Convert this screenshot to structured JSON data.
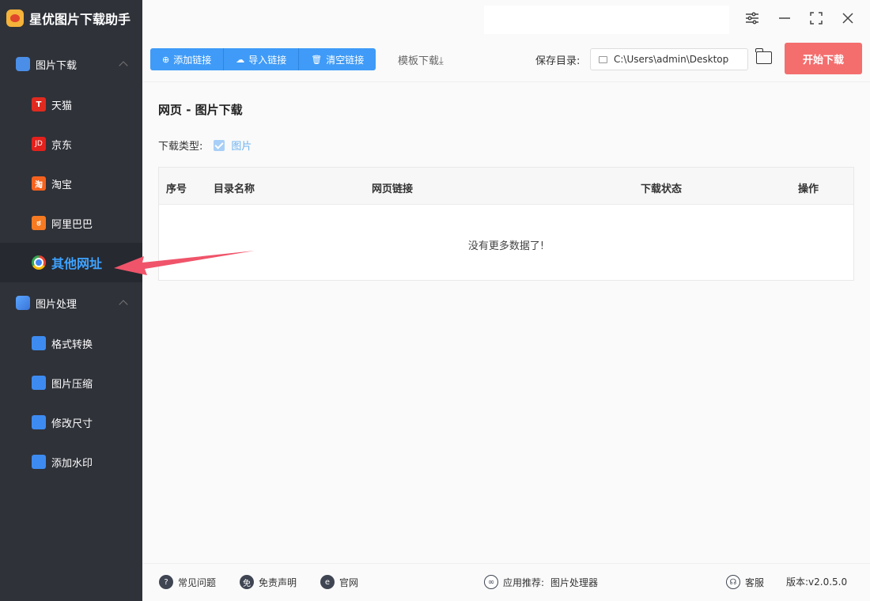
{
  "app": {
    "title": "星优图片下载助手"
  },
  "sidebar": {
    "sections": [
      {
        "label": "图片下载",
        "items": [
          {
            "label": "天猫",
            "icon": "tmall-icon",
            "glyph": "T"
          },
          {
            "label": "京东",
            "icon": "jd-icon",
            "glyph": "JD"
          },
          {
            "label": "淘宝",
            "icon": "taobao-icon",
            "glyph": "淘"
          },
          {
            "label": "阿里巴巴",
            "icon": "alibaba-icon",
            "glyph": "ಠ"
          },
          {
            "label": "其他网址",
            "icon": "chrome-icon",
            "glyph": "",
            "active": true
          }
        ]
      },
      {
        "label": "图片处理",
        "items": [
          {
            "label": "格式转换",
            "icon": "format-convert-icon"
          },
          {
            "label": "图片压缩",
            "icon": "image-compress-icon"
          },
          {
            "label": "修改尺寸",
            "icon": "resize-icon"
          },
          {
            "label": "添加水印",
            "icon": "watermark-icon"
          }
        ]
      }
    ]
  },
  "toolbar": {
    "add_link": "添加链接",
    "import_link": "导入链接",
    "clear_link": "清空链接",
    "template_download": "模板下载",
    "save_dir_label": "保存目录:",
    "save_dir_value": "C:\\Users\\admin\\Desktop",
    "start_download": "开始下载"
  },
  "main": {
    "title": "网页 - 图片下载",
    "download_type_label": "下载类型:",
    "download_type_option": "图片",
    "table": {
      "columns": [
        "序号",
        "目录名称",
        "网页链接",
        "下载状态",
        "操作"
      ],
      "empty_text": "没有更多数据了!"
    }
  },
  "footer": {
    "faq": "常见问题",
    "disclaimer": "免责声明",
    "website": "官网",
    "recommend_label": "应用推荐:",
    "recommend_value": "图片处理器",
    "support": "客服",
    "version": "版本:v2.0.5.0"
  },
  "colors": {
    "sidebar_bg": "#2f3239",
    "accent_blue": "#3f9bf7",
    "active_text": "#3ea3ff",
    "start_button": "#f46e6e",
    "arrow": "#f0546a"
  }
}
